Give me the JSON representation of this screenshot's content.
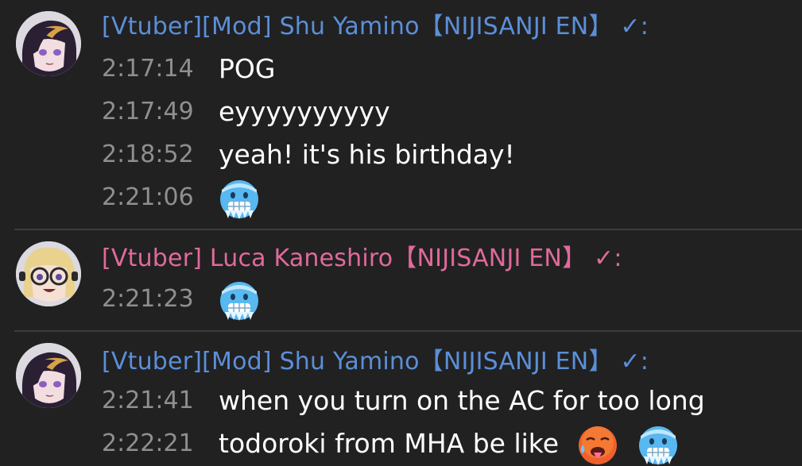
{
  "colors": {
    "background": "#212122",
    "divider": "#3c3c3e",
    "timestamp": "#8f8f92",
    "message": "#ffffff",
    "moderator_name": "#5b8fd8",
    "vtuber_name": "#e06a9a"
  },
  "groups": [
    {
      "avatar_icon": "shu-yamino-avatar",
      "author": "[Vtuber][Mod] Shu Yamino【NIJISANJI EN】 ✓:",
      "messages": [
        {
          "time": "2:17:14",
          "text": "POG",
          "emojis": []
        },
        {
          "time": "2:17:49",
          "text": "eyyyyyyyyyy",
          "emojis": []
        },
        {
          "time": "2:18:52",
          "text": "yeah! it's his birthday!",
          "emojis": []
        },
        {
          "time": "2:21:06",
          "text": "",
          "emojis": [
            "cold-face-emoji"
          ]
        }
      ]
    },
    {
      "avatar_icon": "luca-kaneshiro-avatar",
      "author": "[Vtuber] Luca Kaneshiro【NIJISANJI EN】 ✓:",
      "messages": [
        {
          "time": "2:21:23",
          "text": "",
          "emojis": [
            "cold-face-emoji"
          ]
        }
      ]
    },
    {
      "avatar_icon": "shu-yamino-avatar",
      "author": "[Vtuber][Mod] Shu Yamino【NIJISANJI EN】 ✓:",
      "messages": [
        {
          "time": "2:21:41",
          "text": "when you turn on the AC for too long",
          "emojis": []
        },
        {
          "time": "2:22:21",
          "text": "todoroki from MHA be like",
          "emojis": [
            "hot-face-emoji",
            "cold-face-emoji"
          ]
        }
      ]
    }
  ]
}
